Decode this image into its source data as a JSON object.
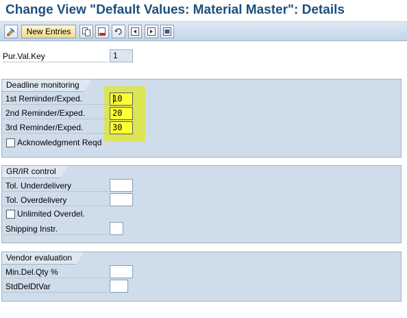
{
  "window": {
    "title": "Change View \"Default Values: Material Master\": Details"
  },
  "toolbar": {
    "new_entries_label": "New Entries",
    "icons": [
      "change-display-icon",
      "copy-icon",
      "delete-icon",
      "undo-icon",
      "first-entry-icon",
      "next-entry-icon",
      "last-entry-icon"
    ]
  },
  "header": {
    "pur_val_key_label": "Pur.Val.Key",
    "pur_val_key_value": "1"
  },
  "deadline_monitoring": {
    "title": "Deadline monitoring",
    "reminder1_label": "1st Reminder/Exped.",
    "reminder1_value": "10",
    "reminder2_label": "2nd Reminder/Exped.",
    "reminder2_value": "20",
    "reminder3_label": "3rd Reminder/Exped.",
    "reminder3_value": "30",
    "ack_label": "Acknowledgment Reqd",
    "highlight_color": "#dfe63a"
  },
  "grir_control": {
    "title": "GR/IR control",
    "tol_under_label": "Tol. Underdelivery",
    "tol_under_value": "",
    "tol_over_label": "Tol. Overdelivery",
    "tol_over_value": "",
    "unlimited_label": "Unlimited Overdel.",
    "shipping_label": "Shipping Instr.",
    "shipping_value": ""
  },
  "vendor_evaluation": {
    "title": "Vendor evaluation",
    "min_del_label": "Min.Del.Qty %",
    "min_del_value": "",
    "std_del_label": "StdDelDtVar",
    "std_del_value": ""
  },
  "colors": {
    "title_color": "#1c4f7f",
    "group_bg": "#cfdcea",
    "field_yellow": "#ffff33"
  }
}
